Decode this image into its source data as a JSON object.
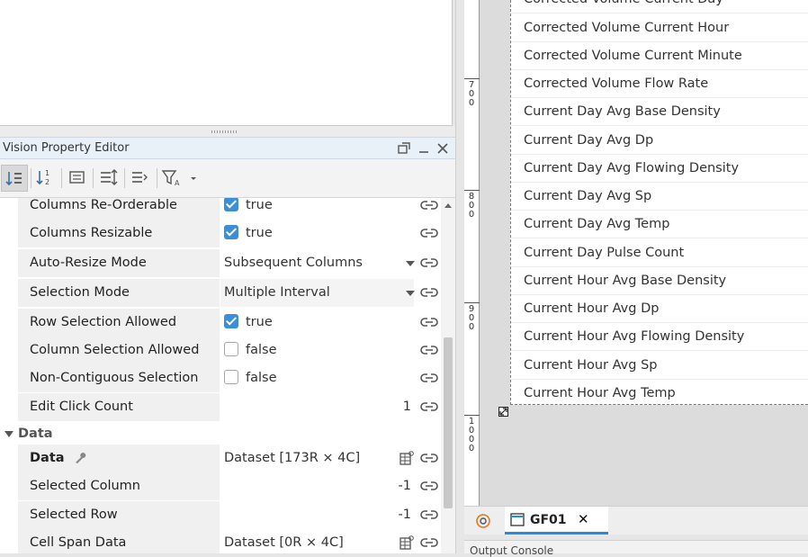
{
  "editor": {
    "title": "Vision Property Editor",
    "rows_top": [
      {
        "name": "Columns Re-Orderable",
        "type": "check",
        "checked": true,
        "value": "true"
      },
      {
        "name": "Columns Resizable",
        "type": "check",
        "checked": true,
        "value": "true"
      },
      {
        "name": "Auto-Resize Mode",
        "type": "dropdown",
        "value": "Subsequent Columns"
      },
      {
        "name": "Selection Mode",
        "type": "dropdown",
        "value": "Multiple Interval"
      },
      {
        "name": "Row Selection Allowed",
        "type": "check",
        "checked": true,
        "value": "true"
      },
      {
        "name": "Column Selection Allowed",
        "type": "check",
        "checked": false,
        "value": "false"
      },
      {
        "name": "Non-Contiguous Selection",
        "type": "check",
        "checked": false,
        "value": "false"
      },
      {
        "name": "Edit Click Count",
        "type": "number",
        "value": "1"
      }
    ],
    "section_data": "Data",
    "rows_data": [
      {
        "name": "Data",
        "type": "dataset",
        "value": "Dataset [173R × 4C]"
      },
      {
        "name": "Selected Column",
        "type": "number",
        "value": "-1"
      },
      {
        "name": "Selected Row",
        "type": "number",
        "value": "-1"
      },
      {
        "name": "Cell Span Data",
        "type": "dataset",
        "value": "Dataset [0R × 4C]"
      }
    ]
  },
  "ruler": [
    "7\n0\n0",
    "8\n0\n0",
    "9\n0\n0",
    "1\n0\n0\n0"
  ],
  "list_items": [
    "Corrected Volume Current Day",
    "Corrected Volume Current Hour",
    "Corrected Volume Current Minute",
    "Corrected Volume Flow Rate",
    "Current Day Avg Base Density",
    "Current Day Avg Dp",
    "Current Day Avg Flowing Density",
    "Current Day Avg Sp",
    "Current Day Avg Temp",
    "Current Day Pulse Count",
    "Current Hour Avg Base Density",
    "Current Hour Avg Dp",
    "Current Hour Avg Flowing Density",
    "Current Hour Avg Sp",
    "Current Hour Avg Temp"
  ],
  "tab": {
    "label": "GF01",
    "close": "✕"
  },
  "output_console": "Output Console",
  "colors": {
    "accent": "#1f8ee8",
    "checkbox": "#3c8fd6"
  }
}
